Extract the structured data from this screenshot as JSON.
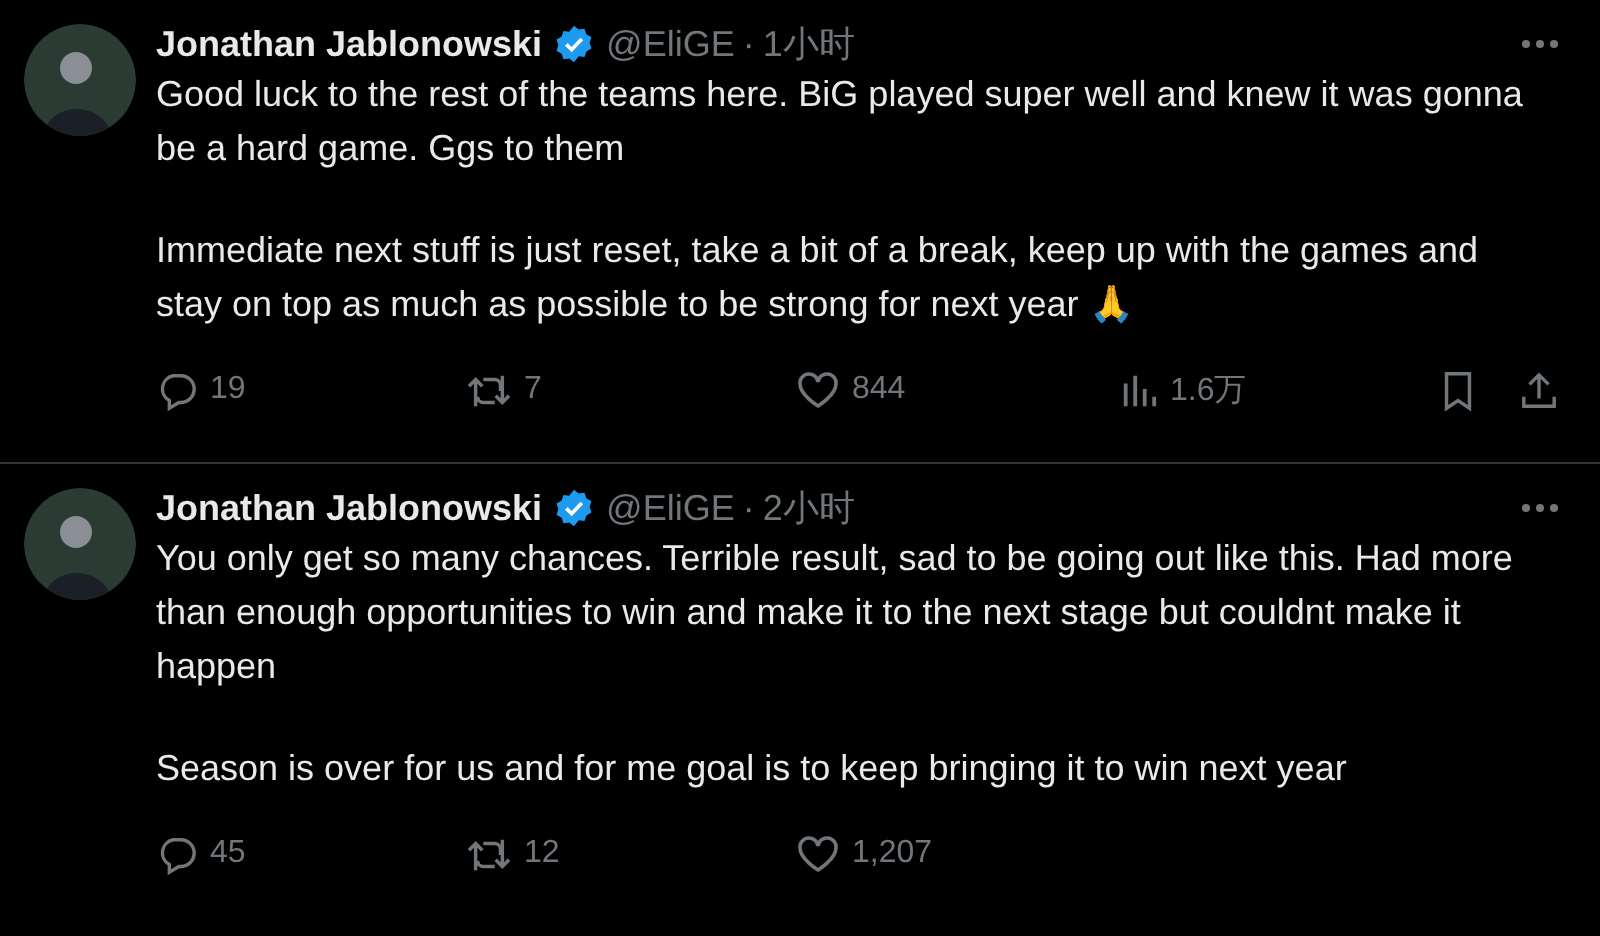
{
  "tweets": [
    {
      "author": {
        "name": "Jonathan Jablonowski",
        "handle": "@EliGE",
        "verified": true
      },
      "separator": "·",
      "time": "1小时",
      "paragraphs": [
        "Good luck to the rest of the teams here. BiG played super well and knew it was gonna be a hard game. Ggs to them",
        "Immediate next stuff is just reset, take a bit of a break, keep up with the games and stay on top as much as possible to be strong for next year 🙏"
      ],
      "actions": [
        {
          "kind": "reply",
          "count": "19"
        },
        {
          "kind": "retweet",
          "count": "7"
        },
        {
          "kind": "like",
          "count": "844"
        },
        {
          "kind": "views",
          "count": "1.6万"
        },
        {
          "kind": "bookmark"
        },
        {
          "kind": "share"
        }
      ]
    },
    {
      "author": {
        "name": "Jonathan Jablonowski",
        "handle": "@EliGE",
        "verified": true
      },
      "separator": "·",
      "time": "2小时",
      "paragraphs": [
        "You only get so many chances. Terrible result, sad to be going out like this. Had more than enough opportunities to win and make it to the next stage but couldnt make it happen",
        "Season is over for us and for me goal is to keep bringing it to win next year"
      ],
      "actions": [
        {
          "kind": "reply",
          "count": "45"
        },
        {
          "kind": "retweet",
          "count": "12"
        },
        {
          "kind": "like",
          "count": "1,207"
        }
      ]
    }
  ]
}
